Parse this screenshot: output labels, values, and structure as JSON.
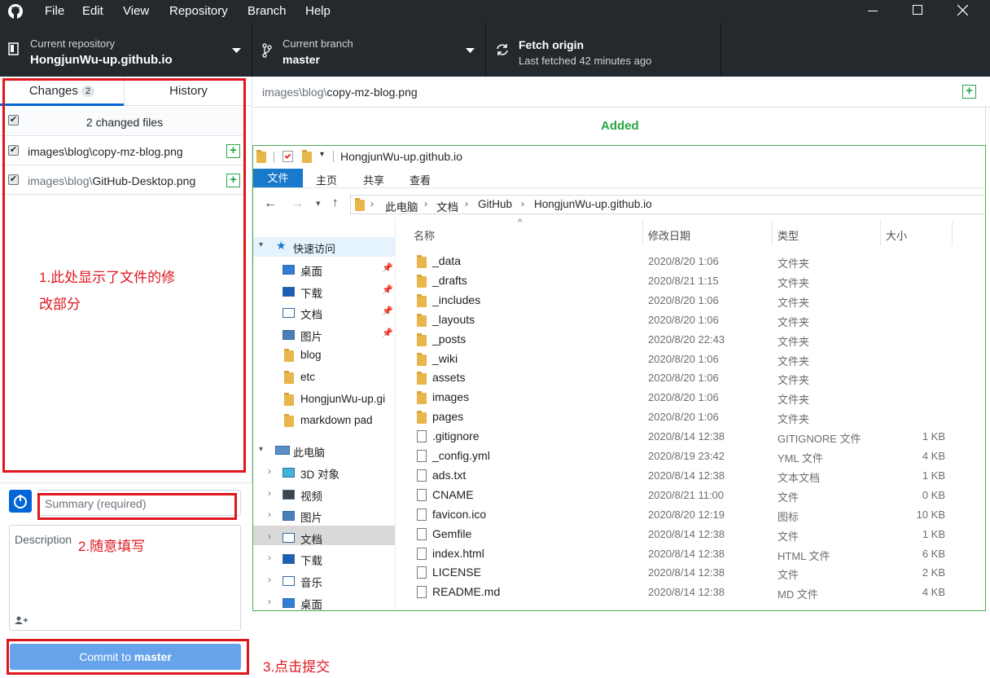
{
  "menu": {
    "items": [
      "File",
      "Edit",
      "View",
      "Repository",
      "Branch",
      "Help"
    ]
  },
  "toolbar": {
    "repo_label": "Current repository",
    "repo_name": "HongjunWu-up.github.io",
    "branch_label": "Current branch",
    "branch_name": "master",
    "fetch_title": "Fetch origin",
    "fetch_sub": "Last fetched 42 minutes ago"
  },
  "tabs": {
    "changes": "Changes",
    "changes_count": "2",
    "history": "History"
  },
  "changes": {
    "summary": "2 changed files",
    "files": [
      {
        "path": "images\\blog\\copy-mz-blog.png"
      },
      {
        "path_dir": "images\\blog\\",
        "path_file": "GitHub-Desktop.png"
      }
    ]
  },
  "annotations": {
    "a1_line1": "1.此处显示了文件的修",
    "a1_line2": "改部分",
    "a2": "2.随意填写",
    "a3": "3.点击提交"
  },
  "commit": {
    "summary_placeholder": "Summary (required)",
    "description_placeholder": "Description",
    "button_prefix": "Commit to ",
    "button_branch": "master"
  },
  "diff": {
    "path_dir": "images\\blog\\",
    "path_file": "copy-mz-blog.png",
    "status": "Added"
  },
  "explorer": {
    "title": "HongjunWu-up.github.io",
    "ribbon": [
      "文件",
      "主页",
      "共享",
      "查看"
    ],
    "breadcrumb": [
      "此电脑",
      "文档",
      "GitHub",
      "HongjunWu-up.github.io"
    ],
    "columns": [
      "名称",
      "修改日期",
      "类型",
      "大小"
    ],
    "nav": {
      "quick_access": "快速访问",
      "quick_items": [
        "桌面",
        "下载",
        "文档",
        "图片",
        "blog",
        "etc",
        "HongjunWu-up.gi",
        "markdown pad"
      ],
      "this_pc": "此电脑",
      "pc_items": [
        "3D 对象",
        "视频",
        "图片",
        "文档",
        "下载",
        "音乐",
        "桌面"
      ]
    },
    "files": [
      {
        "name": "_data",
        "date": "2020/8/20 1:06",
        "type": "文件夹",
        "size": "",
        "kind": "folder"
      },
      {
        "name": "_drafts",
        "date": "2020/8/21 1:15",
        "type": "文件夹",
        "size": "",
        "kind": "folder"
      },
      {
        "name": "_includes",
        "date": "2020/8/20 1:06",
        "type": "文件夹",
        "size": "",
        "kind": "folder"
      },
      {
        "name": "_layouts",
        "date": "2020/8/20 1:06",
        "type": "文件夹",
        "size": "",
        "kind": "folder"
      },
      {
        "name": "_posts",
        "date": "2020/8/20 22:43",
        "type": "文件夹",
        "size": "",
        "kind": "folder"
      },
      {
        "name": "_wiki",
        "date": "2020/8/20 1:06",
        "type": "文件夹",
        "size": "",
        "kind": "folder"
      },
      {
        "name": "assets",
        "date": "2020/8/20 1:06",
        "type": "文件夹",
        "size": "",
        "kind": "folder"
      },
      {
        "name": "images",
        "date": "2020/8/20 1:06",
        "type": "文件夹",
        "size": "",
        "kind": "folder"
      },
      {
        "name": "pages",
        "date": "2020/8/20 1:06",
        "type": "文件夹",
        "size": "",
        "kind": "folder"
      },
      {
        "name": ".gitignore",
        "date": "2020/8/14 12:38",
        "type": "GITIGNORE 文件",
        "size": "1 KB",
        "kind": "doc"
      },
      {
        "name": "_config.yml",
        "date": "2020/8/19 23:42",
        "type": "YML 文件",
        "size": "4 KB",
        "kind": "doc"
      },
      {
        "name": "ads.txt",
        "date": "2020/8/14 12:38",
        "type": "文本文档",
        "size": "1 KB",
        "kind": "doc"
      },
      {
        "name": "CNAME",
        "date": "2020/8/21 11:00",
        "type": "文件",
        "size": "0 KB",
        "kind": "doc"
      },
      {
        "name": "favicon.ico",
        "date": "2020/8/20 12:19",
        "type": "图标",
        "size": "10 KB",
        "kind": "doc"
      },
      {
        "name": "Gemfile",
        "date": "2020/8/14 12:38",
        "type": "文件",
        "size": "1 KB",
        "kind": "doc"
      },
      {
        "name": "index.html",
        "date": "2020/8/14 12:38",
        "type": "HTML 文件",
        "size": "6 KB",
        "kind": "doc"
      },
      {
        "name": "LICENSE",
        "date": "2020/8/14 12:38",
        "type": "文件",
        "size": "2 KB",
        "kind": "doc"
      },
      {
        "name": "README.md",
        "date": "2020/8/14 12:38",
        "type": "MD 文件",
        "size": "4 KB",
        "kind": "doc"
      }
    ]
  }
}
